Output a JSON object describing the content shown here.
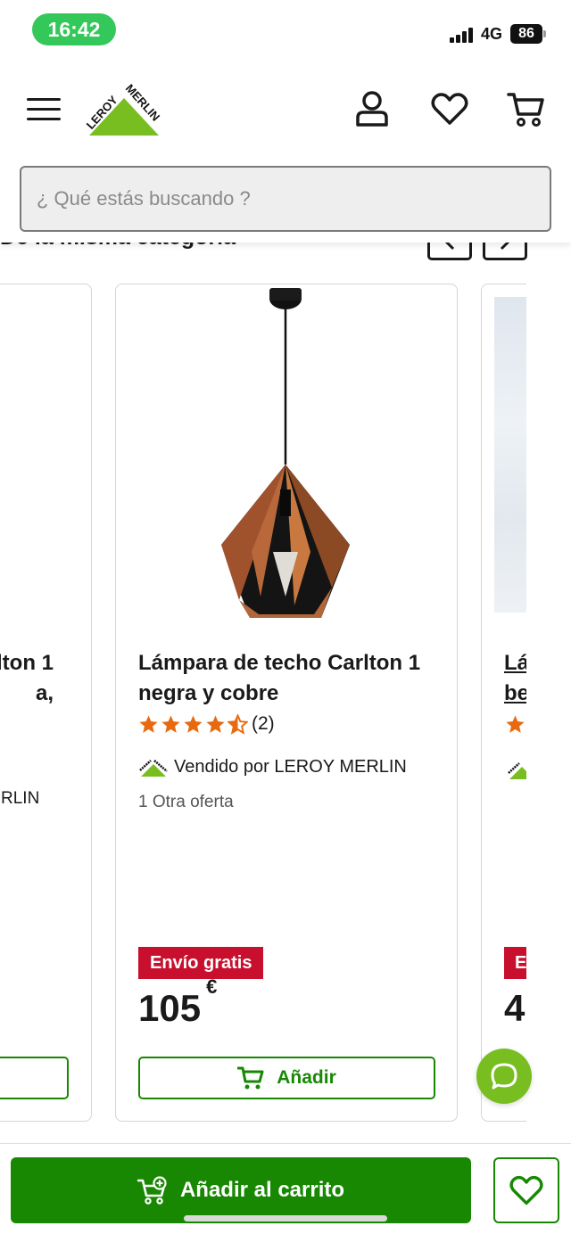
{
  "status_bar": {
    "time": "16:42",
    "network": "4G",
    "battery": "86"
  },
  "header": {
    "search_placeholder": "¿ Qué estás buscando ?"
  },
  "section": {
    "title": "De la misma categoría"
  },
  "left_card": {
    "title": "lton 1\na,",
    "seller": "RLIN"
  },
  "product": {
    "title": "Lámpara de techo Carlton 1 negra y cobre",
    "rating": 4.5,
    "review_count": "(2)",
    "seller": "Vendido por LEROY MERLIN",
    "offers": "1 Otra oferta",
    "badge": "Envío gratis",
    "price": "105",
    "currency": "€",
    "add_label": "Añadir"
  },
  "right_card": {
    "title": "Lá\nbe",
    "badge": "E",
    "price": "4"
  },
  "bottom_bar": {
    "cart_label": "Añadir al carrito"
  },
  "colors": {
    "brand_green": "#188803",
    "logo_green": "#78be20",
    "badge_red": "#c8102e",
    "star_orange": "#e86a10"
  }
}
